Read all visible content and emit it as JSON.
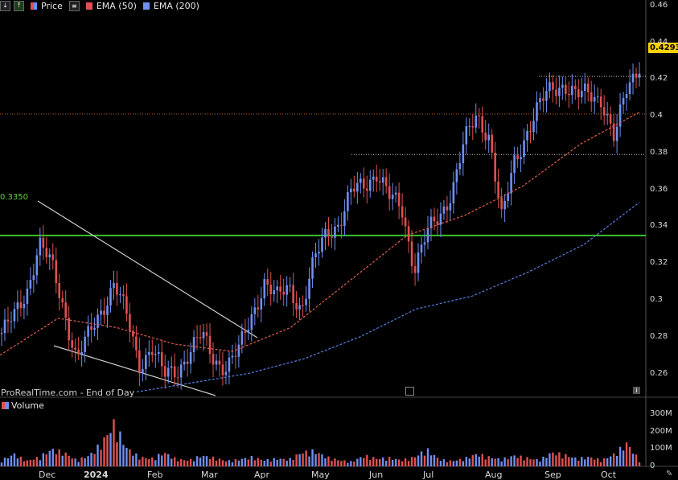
{
  "legend": {
    "price_label": "Price",
    "ema50_label": "EMA (50)",
    "ema200_label": "EMA (200)"
  },
  "volume_label": "Volume",
  "watermark": "ProRealTime.com - End of Day",
  "price_tag": "0.4293",
  "level_tag": "0.3350",
  "colors": {
    "up": "#6f8ff2",
    "down": "#e05050",
    "ema50": "#e0604a",
    "ema200": "#5b7fe0",
    "support": "#39c02e",
    "price_tag": "#ffd200"
  },
  "chart_data": [
    {
      "type": "line",
      "subtype": "candlestick",
      "x_ticks": [
        "Dec",
        "2024",
        "Feb",
        "Mar",
        "Apr",
        "May",
        "Jun",
        "Jul",
        "Aug",
        "Sep",
        "Oct"
      ],
      "y_ticks": [
        "0.46",
        "0.44",
        "0.42",
        "0.4",
        "0.38",
        "0.36",
        "0.34",
        "0.32",
        "0.3",
        "0.28",
        "0.26"
      ],
      "ylim": [
        0.248,
        0.463
      ],
      "last_price": 0.4293,
      "horizontal_levels": [
        {
          "value": 0.335,
          "style": "solid-green"
        },
        {
          "value": 0.401,
          "style": "dotted-orange"
        }
      ],
      "series": [
        {
          "name": "Price",
          "kind": "close",
          "points": [
            [
              "Nov 2023",
              0.282
            ],
            [
              "Nov 2023",
              0.29
            ],
            [
              "Nov 2023",
              0.305
            ],
            [
              "Dec 2023",
              0.331
            ],
            [
              "Dec 2023",
              0.318
            ],
            [
              "Dec 2023",
              0.295
            ],
            [
              "Dec 2023",
              0.268
            ],
            [
              "Dec 2023",
              0.28
            ],
            [
              "Jan 2024",
              0.295
            ],
            [
              "Jan 2024",
              0.31
            ],
            [
              "Jan 2024",
              0.29
            ],
            [
              "Jan 2024",
              0.265
            ],
            [
              "Jan 2024",
              0.275
            ],
            [
              "Feb 2024",
              0.258
            ],
            [
              "Feb 2024",
              0.262
            ],
            [
              "Feb 2024",
              0.272
            ],
            [
              "Feb 2024",
              0.28
            ],
            [
              "Mar 2024",
              0.268
            ],
            [
              "Mar 2024",
              0.264
            ],
            [
              "Mar 2024",
              0.272
            ],
            [
              "Mar 2024",
              0.292
            ],
            [
              "Apr 2024",
              0.31
            ],
            [
              "Apr 2024",
              0.3
            ],
            [
              "Apr 2024",
              0.308
            ],
            [
              "Apr 2024",
              0.295
            ],
            [
              "May 2024",
              0.32
            ],
            [
              "May 2024",
              0.338
            ],
            [
              "May 2024",
              0.342
            ],
            [
              "May 2024",
              0.358
            ],
            [
              "May 2024",
              0.363
            ],
            [
              "Jun 2024",
              0.37
            ],
            [
              "Jun 2024",
              0.355
            ],
            [
              "Jun 2024",
              0.35
            ],
            [
              "Jun 2024",
              0.318
            ],
            [
              "Jul 2024",
              0.335
            ],
            [
              "Jul 2024",
              0.345
            ],
            [
              "Jul 2024",
              0.36
            ],
            [
              "Jul 2024",
              0.385
            ],
            [
              "Jul 2024",
              0.4
            ],
            [
              "Aug 2024",
              0.39
            ],
            [
              "Aug 2024",
              0.342
            ],
            [
              "Aug 2024",
              0.375
            ],
            [
              "Aug 2024",
              0.392
            ],
            [
              "Aug 2024",
              0.405
            ],
            [
              "Sep 2024",
              0.415
            ],
            [
              "Sep 2024",
              0.418
            ],
            [
              "Sep 2024",
              0.41
            ],
            [
              "Sep 2024",
              0.412
            ],
            [
              "Oct 2024",
              0.41
            ],
            [
              "Oct 2024",
              0.386
            ],
            [
              "Oct 2024",
              0.415
            ],
            [
              "Oct 2024",
              0.4293
            ]
          ]
        },
        {
          "name": "EMA (50)",
          "kind": "ema",
          "points": [
            [
              "Nov 2023",
              0.27
            ],
            [
              "Dec 2023",
              0.29
            ],
            [
              "Jan 2024",
              0.285
            ],
            [
              "Feb 2024",
              0.276
            ],
            [
              "Mar 2024",
              0.272
            ],
            [
              "Apr 2024",
              0.285
            ],
            [
              "May 2024",
              0.31
            ],
            [
              "Jun 2024",
              0.335
            ],
            [
              "Jul 2024",
              0.346
            ],
            [
              "Aug 2024",
              0.362
            ],
            [
              "Sep 2024",
              0.385
            ],
            [
              "Oct 2024",
              0.402
            ]
          ]
        },
        {
          "name": "EMA (200)",
          "kind": "ema",
          "points": [
            [
              "Jan 2024",
              0.25
            ],
            [
              "Feb 2024",
              0.255
            ],
            [
              "Mar 2024",
              0.26
            ],
            [
              "Apr 2024",
              0.268
            ],
            [
              "May 2024",
              0.28
            ],
            [
              "Jun 2024",
              0.295
            ],
            [
              "Jul 2024",
              0.302
            ],
            [
              "Aug 2024",
              0.315
            ],
            [
              "Sep 2024",
              0.33
            ],
            [
              "Oct 2024",
              0.353
            ]
          ]
        }
      ]
    },
    {
      "type": "bar",
      "name": "Volume",
      "y_ticks": [
        "300M",
        "200M",
        "100M",
        "0"
      ],
      "ylim": [
        0,
        300
      ],
      "y_unit": "M",
      "values_sample": [
        40,
        80,
        35,
        60,
        110,
        90,
        40,
        70,
        150,
        280,
        120,
        60,
        50,
        90,
        45,
        40,
        70,
        55,
        35,
        45,
        60,
        40,
        50,
        45,
        90,
        100,
        60,
        40,
        30,
        70,
        50,
        55,
        40,
        60,
        110,
        45,
        35,
        50,
        80,
        60,
        45,
        70,
        55,
        40,
        90,
        75,
        50,
        60,
        40,
        80,
        150,
        40
      ]
    }
  ]
}
